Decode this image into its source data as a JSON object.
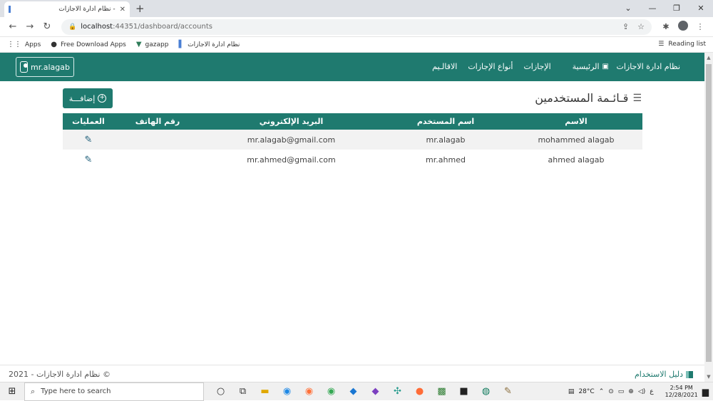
{
  "browser": {
    "tab_title": "نظام ادارة الاجازات -",
    "url_host": "localhost",
    "url_rest": ":44351/dashboard/accounts",
    "bookmarks": [
      {
        "icon": "apps-grid-icon",
        "label": "Apps"
      },
      {
        "icon": "globe-icon",
        "label": "Free Download Apps"
      },
      {
        "icon": "vue-icon",
        "label": "gazapp"
      },
      {
        "icon": "page-icon",
        "label": "نظام ادارة الاجازات"
      }
    ],
    "reading_list": "Reading list"
  },
  "navbar": {
    "brand": "نظام ادارة الاجازات",
    "links": [
      "الرئيسية",
      "الإجازات",
      "أنواع الإجازات",
      "الاقالـيم"
    ],
    "user": "mr.alagab"
  },
  "page": {
    "title": "قـائـمة المستخدمين",
    "add_button": "إضافـــة"
  },
  "table": {
    "headers": [
      "الاسم",
      "اسم المستخدم",
      "البريد الإلكتروني",
      "رقم الهاتف",
      "العمليات"
    ],
    "rows": [
      {
        "name": "mohammed alagab",
        "username": "mr.alagab",
        "email": "mr.alagab@gmail.com",
        "phone": ""
      },
      {
        "name": "ahmed alagab",
        "username": "mr.ahmed",
        "email": "mr.ahmed@gmail.com",
        "phone": ""
      }
    ]
  },
  "footer": {
    "copyright": "نظام ادارة الاجازات - 2021 ©",
    "guide": "دليل الاستخدام"
  },
  "taskbar": {
    "search_placeholder": "Type here to search",
    "temperature": "28°C",
    "lang": "ع",
    "time": "2:54 PM",
    "date": "12/28/2021"
  },
  "colors": {
    "primary": "#1f7a6f"
  }
}
